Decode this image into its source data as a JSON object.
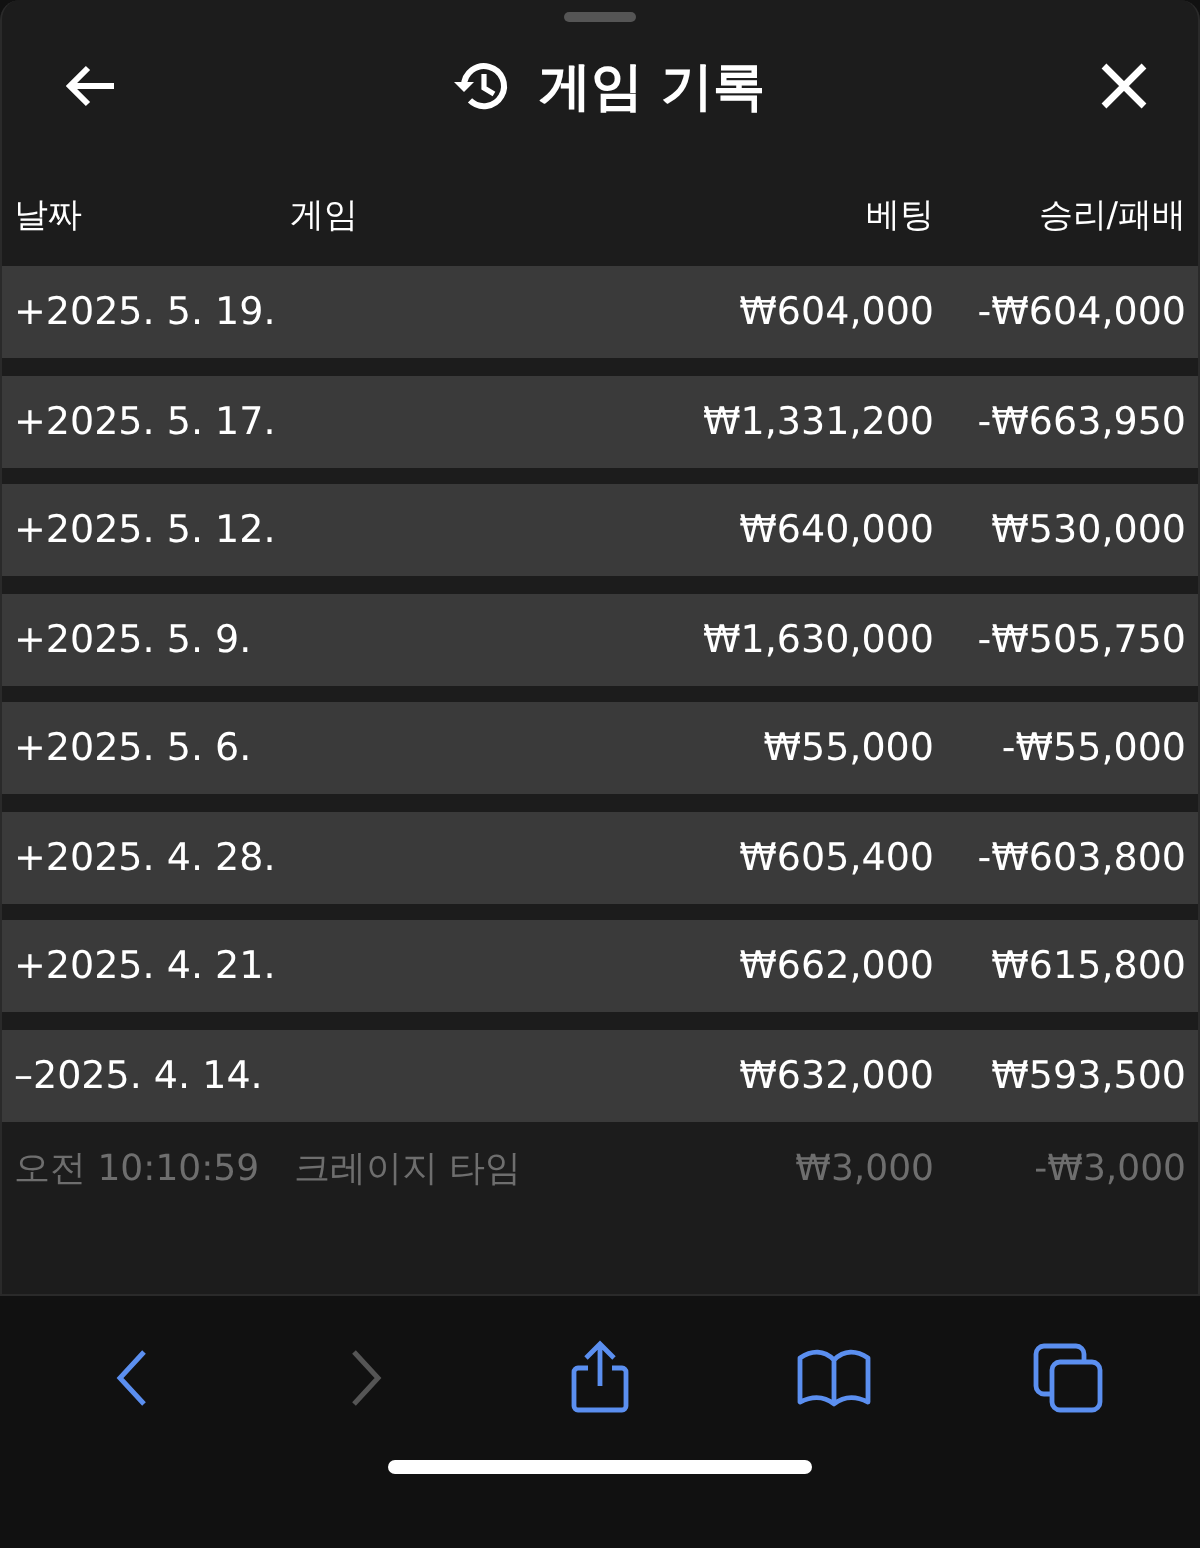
{
  "header": {
    "title": "게임 기록"
  },
  "columns": [
    "날짜",
    "게임",
    "베팅",
    "승리/패배"
  ],
  "rows": [
    {
      "toggle": "+",
      "date": "2025. 5. 19.",
      "bet": "₩604,000",
      "result": "-₩604,000"
    },
    {
      "toggle": "+",
      "date": "2025. 5. 17.",
      "bet": "₩1,331,200",
      "result": "-₩663,950"
    },
    {
      "toggle": "+",
      "date": "2025. 5. 12.",
      "bet": "₩640,000",
      "result": "₩530,000"
    },
    {
      "toggle": "+",
      "date": "2025. 5. 9.",
      "bet": "₩1,630,000",
      "result": "-₩505,750"
    },
    {
      "toggle": "+",
      "date": "2025. 5. 6.",
      "bet": "₩55,000",
      "result": "-₩55,000"
    },
    {
      "toggle": "+",
      "date": "2025. 4. 28.",
      "bet": "₩605,400",
      "result": "-₩603,800"
    },
    {
      "toggle": "+",
      "date": "2025. 4. 21.",
      "bet": "₩662,000",
      "result": "₩615,800"
    },
    {
      "toggle": "–",
      "date": "2025. 4. 14.",
      "bet": "₩632,000",
      "result": "₩593,500",
      "children": [
        {
          "time": "오전 10:10:59",
          "game": "크레이지 타임",
          "bet": "₩3,000",
          "result": "-₩3,000"
        }
      ]
    }
  ],
  "toolbar": [
    {
      "kind": "back",
      "disabled": false
    },
    {
      "kind": "forward",
      "disabled": true
    },
    {
      "kind": "share",
      "disabled": false
    },
    {
      "kind": "bookmarks",
      "disabled": false
    },
    {
      "kind": "tabs",
      "disabled": false
    }
  ]
}
